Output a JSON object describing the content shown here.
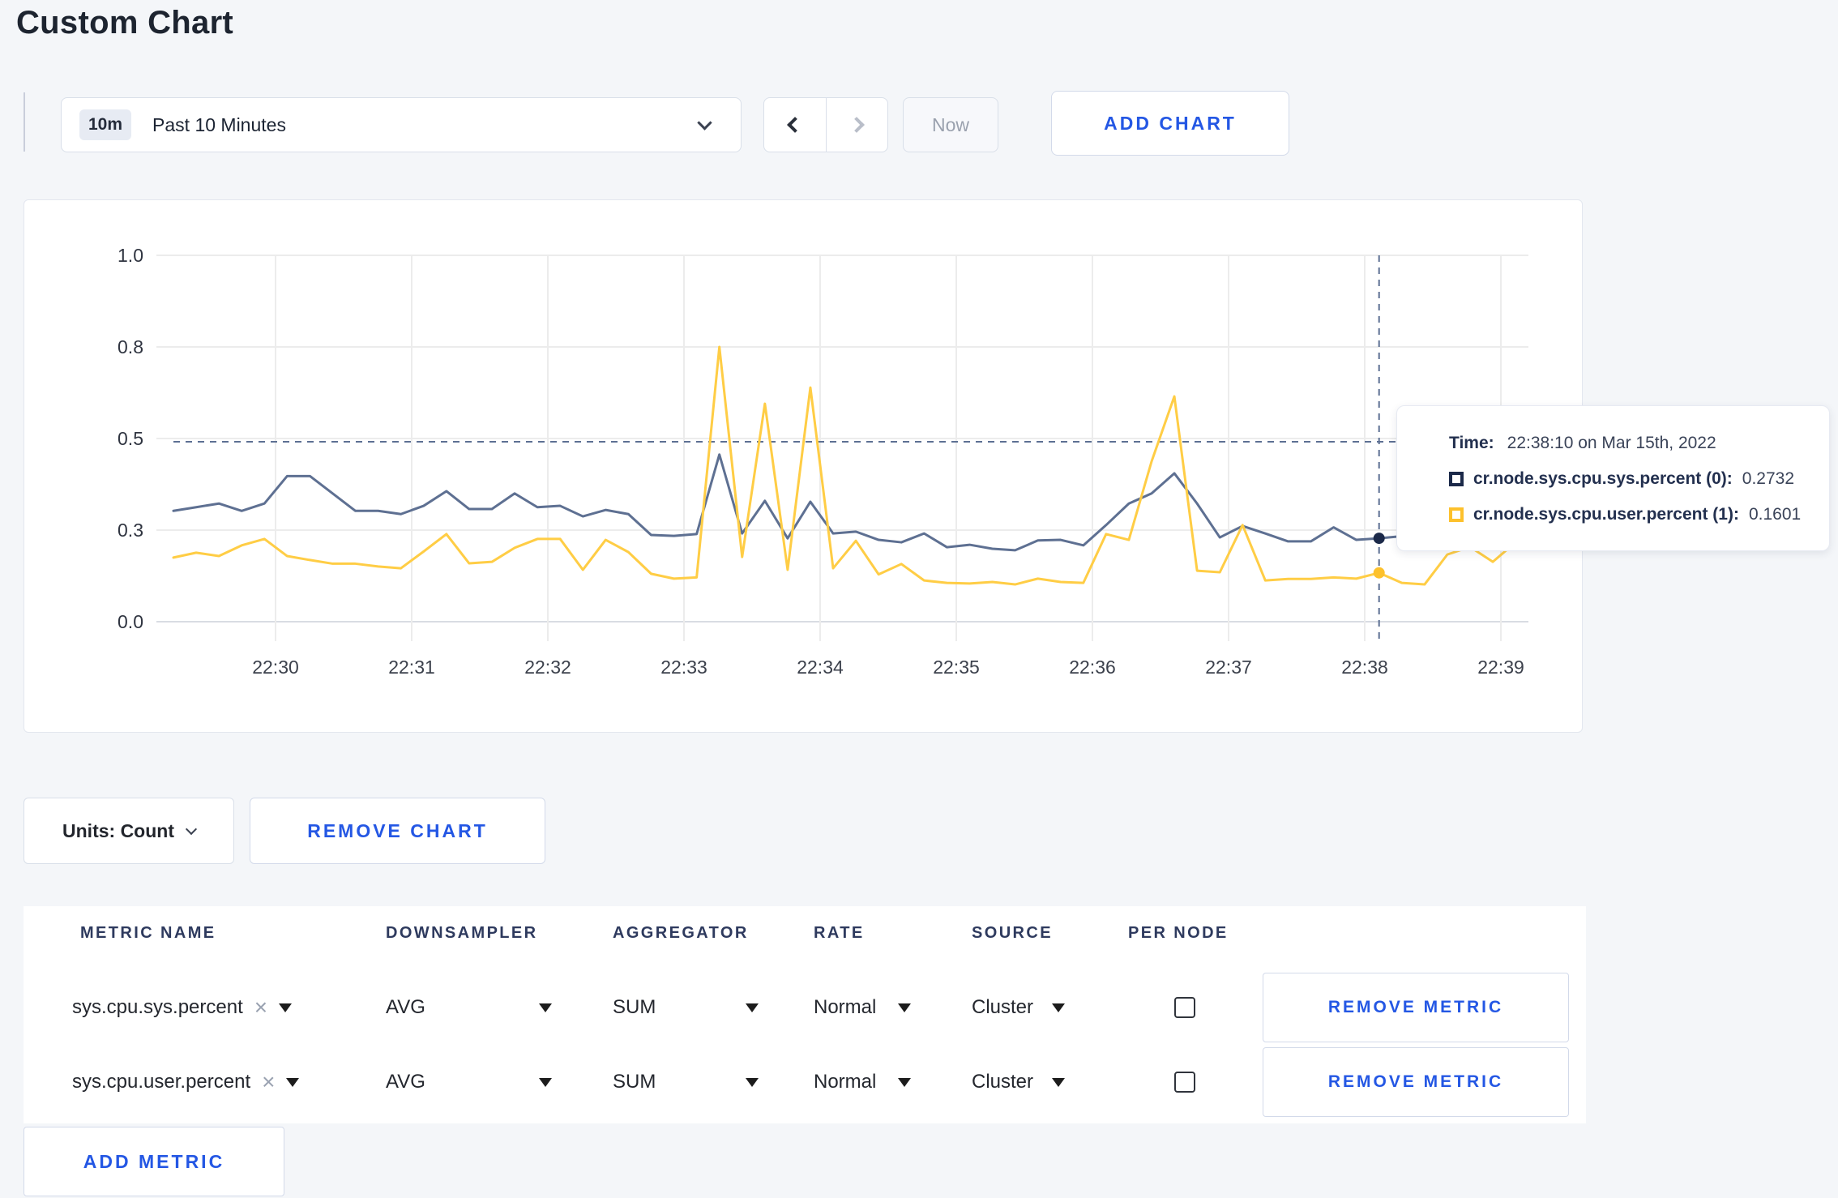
{
  "page": {
    "title": "Custom Chart",
    "background": "#f4f6f9",
    "accent_blue": "#2457e4"
  },
  "toolbar": {
    "time_badge": "10m",
    "time_label": "Past 10 Minutes",
    "now_label": "Now",
    "add_chart_label": "ADD CHART"
  },
  "chart_controls": {
    "units_label": "Units: Count",
    "remove_chart_label": "REMOVE CHART",
    "add_metric_label": "ADD METRIC"
  },
  "tooltip": {
    "time_label": "Time:",
    "time_value": "22:38:10 on Mar 15th, 2022",
    "series": [
      {
        "label": "cr.node.sys.cpu.sys.percent (0):",
        "value": "0.2732",
        "color": "#1b2949"
      },
      {
        "label": "cr.node.sys.cpu.user.percent (1):",
        "value": "0.1601",
        "color": "#fdc12c"
      }
    ]
  },
  "table": {
    "headers": [
      "METRIC NAME",
      "DOWNSAMPLER",
      "AGGREGATOR",
      "RATE",
      "SOURCE",
      "PER NODE"
    ],
    "remove_metric_label": "REMOVE METRIC",
    "rows": [
      {
        "metric": "sys.cpu.sys.percent",
        "downsampler": "AVG",
        "aggregator": "SUM",
        "rate": "Normal",
        "source": "Cluster",
        "per_node_checked": false
      },
      {
        "metric": "sys.cpu.user.percent",
        "downsampler": "AVG",
        "aggregator": "SUM",
        "rate": "Normal",
        "source": "Cluster",
        "per_node_checked": false
      }
    ]
  },
  "chart_data": {
    "type": "line",
    "title": "",
    "xlabel": "",
    "ylabel": "",
    "grid": true,
    "legend_position": "tooltip",
    "y_ticks": [
      "1.0",
      "0.8",
      "0.5",
      "0.3",
      "0.0"
    ],
    "y_axis_note": "tick values 0.0/0.3/0.5/0.8/1.0 are evenly spaced (non-linear scale)",
    "x_ticks": [
      "22:30",
      "22:31",
      "22:32",
      "22:33",
      "22:34",
      "22:35",
      "22:36",
      "22:37",
      "22:38",
      "22:39"
    ],
    "times": [
      "22:29:20",
      "22:29:30",
      "22:29:40",
      "22:29:50",
      "22:30:00",
      "22:30:10",
      "22:30:20",
      "22:30:30",
      "22:30:40",
      "22:30:50",
      "22:31:00",
      "22:31:10",
      "22:31:20",
      "22:31:30",
      "22:31:40",
      "22:31:50",
      "22:32:00",
      "22:32:10",
      "22:32:20",
      "22:32:30",
      "22:32:40",
      "22:32:50",
      "22:33:00",
      "22:33:10",
      "22:33:20",
      "22:33:30",
      "22:33:40",
      "22:33:50",
      "22:34:00",
      "22:34:10",
      "22:34:20",
      "22:34:30",
      "22:34:40",
      "22:34:50",
      "22:35:00",
      "22:35:10",
      "22:35:20",
      "22:35:30",
      "22:35:40",
      "22:35:50",
      "22:36:00",
      "22:36:10",
      "22:36:20",
      "22:36:30",
      "22:36:40",
      "22:36:50",
      "22:37:00",
      "22:37:10",
      "22:37:20",
      "22:37:30",
      "22:37:40",
      "22:37:50",
      "22:38:00",
      "22:38:10",
      "22:38:20",
      "22:38:30",
      "22:38:40",
      "22:38:50",
      "22:39:00",
      "22:39:10"
    ],
    "series": [
      {
        "name": "cr.node.sys.cpu.sys.percent",
        "color": "#5e7092",
        "legend_color": "#1b2949",
        "values": [
          0.342,
          0.35,
          0.358,
          0.342,
          0.358,
          0.418,
          0.418,
          0.38,
          0.342,
          0.342,
          0.335,
          0.353,
          0.385,
          0.346,
          0.346,
          0.38,
          0.35,
          0.353,
          0.33,
          0.344,
          0.335,
          0.284,
          0.281,
          0.287,
          0.465,
          0.289,
          0.364,
          0.273,
          0.362,
          0.289,
          0.295,
          0.268,
          0.26,
          0.289,
          0.244,
          0.252,
          0.239,
          0.234,
          0.266,
          0.268,
          0.25,
          0.311,
          0.358,
          0.38,
          0.424,
          0.358,
          0.276,
          0.309,
          0.289,
          0.263,
          0.263,
          0.306,
          0.268,
          0.2732,
          0.28,
          0.29,
          0.28,
          0.275,
          0.285,
          0.28
        ]
      },
      {
        "name": "cr.node.sys.cpu.user.percent",
        "color": "#ffcd45",
        "legend_color": "#fdc12c",
        "values": [
          0.21,
          0.226,
          0.215,
          0.25,
          0.271,
          0.215,
          0.202,
          0.19,
          0.19,
          0.181,
          0.175,
          0.23,
          0.287,
          0.191,
          0.196,
          0.242,
          0.271,
          0.271,
          0.17,
          0.268,
          0.228,
          0.157,
          0.141,
          0.145,
          0.8,
          0.212,
          0.614,
          0.17,
          0.667,
          0.175,
          0.265,
          0.155,
          0.189,
          0.135,
          0.127,
          0.125,
          0.13,
          0.122,
          0.141,
          0.13,
          0.127,
          0.287,
          0.268,
          0.45,
          0.638,
          0.167,
          0.162,
          0.311,
          0.135,
          0.14,
          0.14,
          0.145,
          0.141,
          0.1601,
          0.127,
          0.122,
          0.22,
          0.245,
          0.196,
          0.26
        ]
      }
    ],
    "crosshair": {
      "time": "22:38:10",
      "index": 53,
      "hline_value": 0.493
    }
  }
}
